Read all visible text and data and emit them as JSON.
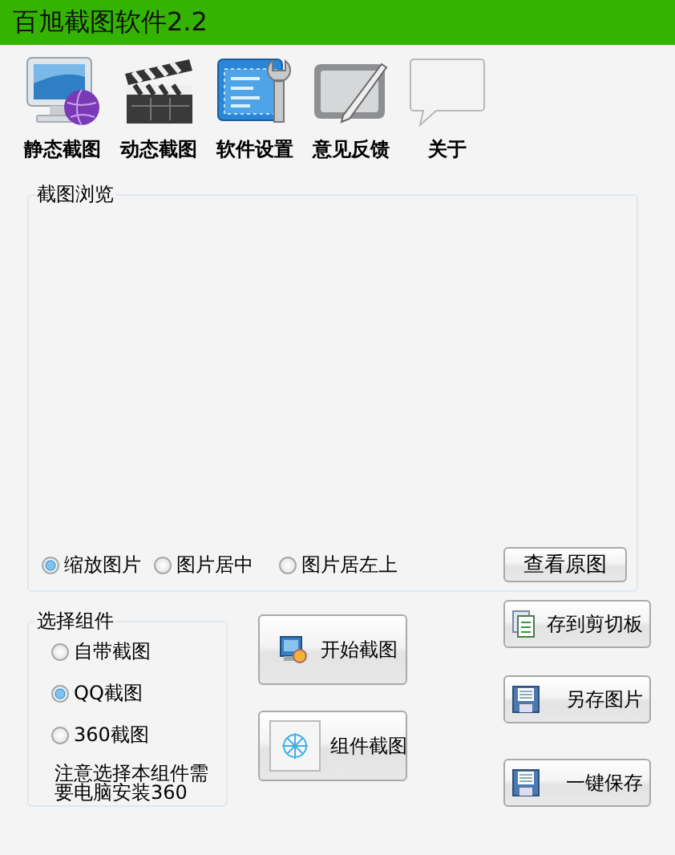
{
  "window": {
    "title": "百旭截图软件2.2"
  },
  "toolbar": [
    {
      "label": "静态截图",
      "kind": "monitor"
    },
    {
      "label": "动态截图",
      "kind": "clapper"
    },
    {
      "label": "软件设置",
      "kind": "settings"
    },
    {
      "label": "意见反馈",
      "kind": "tablet"
    },
    {
      "label": "关于",
      "kind": "bubble"
    }
  ],
  "preview": {
    "title": "截图浏览",
    "display_modes": [
      {
        "label": "缩放图片",
        "selected": true
      },
      {
        "label": "图片居中",
        "selected": false
      },
      {
        "label": "图片居左上",
        "selected": false
      }
    ],
    "view_button": "查看原图"
  },
  "components": {
    "title": "选择组件",
    "options": [
      {
        "label": "自带截图",
        "selected": false
      },
      {
        "label": "QQ截图",
        "selected": true
      },
      {
        "label": "360截图",
        "selected": false
      }
    ],
    "note": "注意选择本组件需要电脑安装360"
  },
  "capture_buttons": [
    {
      "label": "开始截图",
      "kind": "start"
    },
    {
      "label": "组件截图",
      "kind": "component"
    }
  ],
  "save_buttons": [
    {
      "label": "存到剪切板",
      "kind": "clipboard"
    },
    {
      "label": "另存图片",
      "kind": "disk"
    },
    {
      "label": "一键保存",
      "kind": "disk"
    }
  ]
}
